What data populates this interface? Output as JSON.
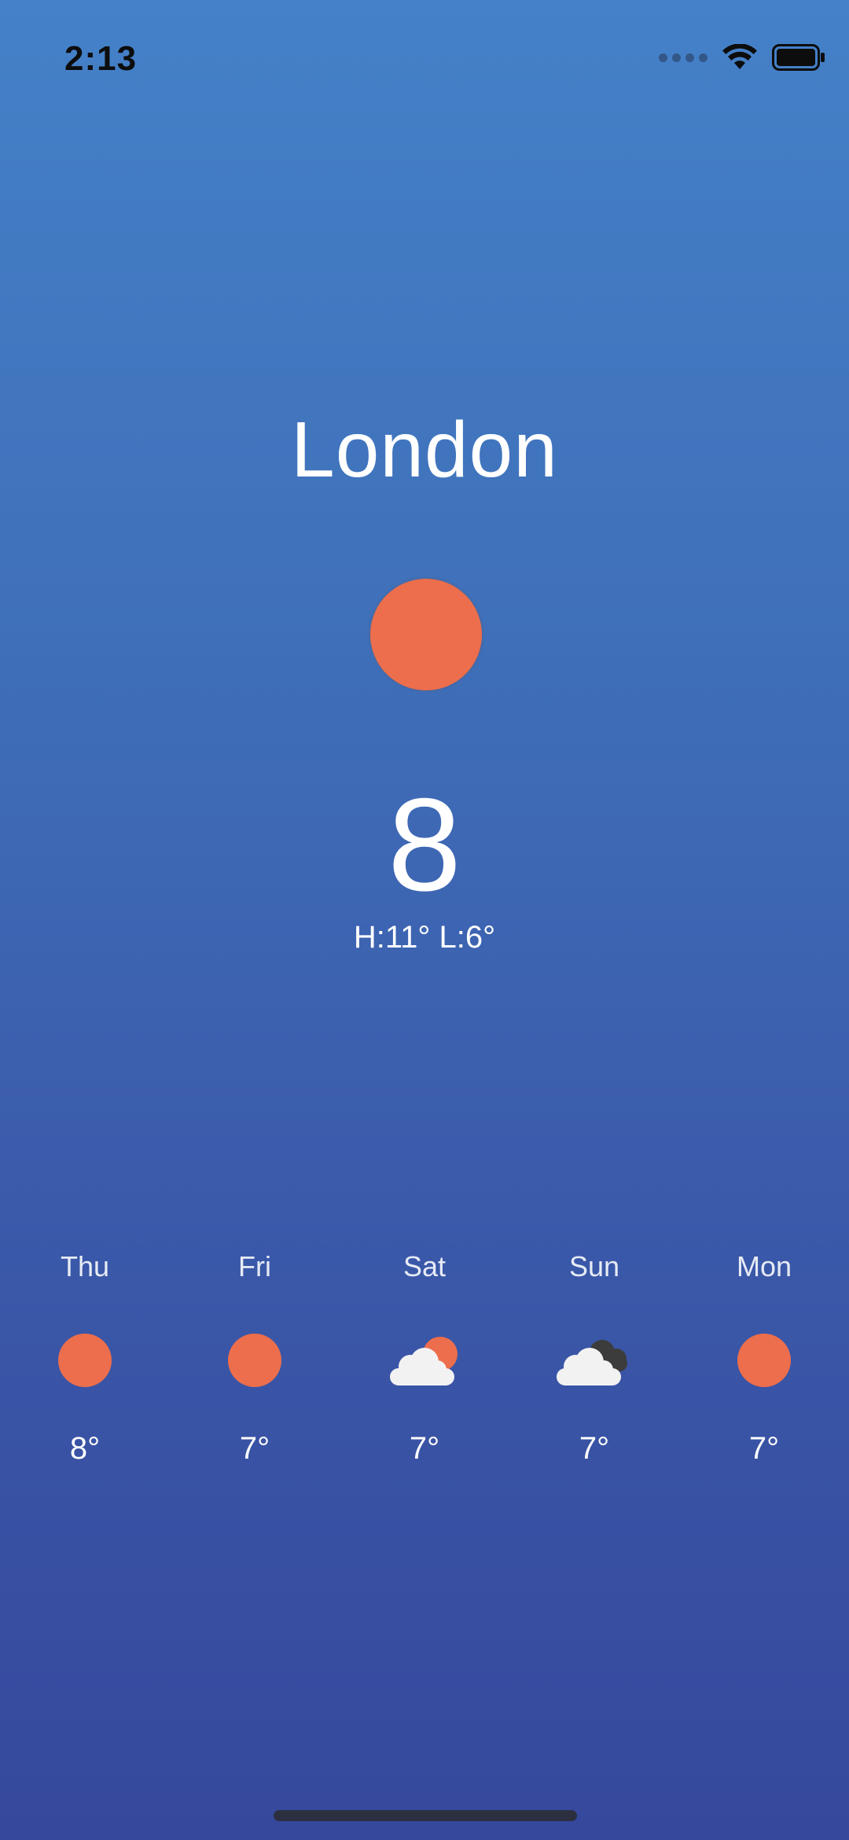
{
  "status_bar": {
    "time": "2:13"
  },
  "current": {
    "city": "London",
    "temperature": "8",
    "hilo": "H:11° L:6°",
    "icon": "sun-icon"
  },
  "forecast": [
    {
      "day": "Thu",
      "temp": "8°",
      "icon": "sun-icon"
    },
    {
      "day": "Fri",
      "temp": "7°",
      "icon": "sun-icon"
    },
    {
      "day": "Sat",
      "temp": "7°",
      "icon": "partly-cloudy-icon"
    },
    {
      "day": "Sun",
      "temp": "7°",
      "icon": "cloudy-icon"
    },
    {
      "day": "Mon",
      "temp": "7°",
      "icon": "sun-icon"
    }
  ],
  "colors": {
    "sun": "#ec6e4c",
    "cloud_light": "#f2f2f2",
    "cloud_dark": "#3c3c3c",
    "background_top": "#4481c8",
    "background_bottom": "#36489c"
  }
}
